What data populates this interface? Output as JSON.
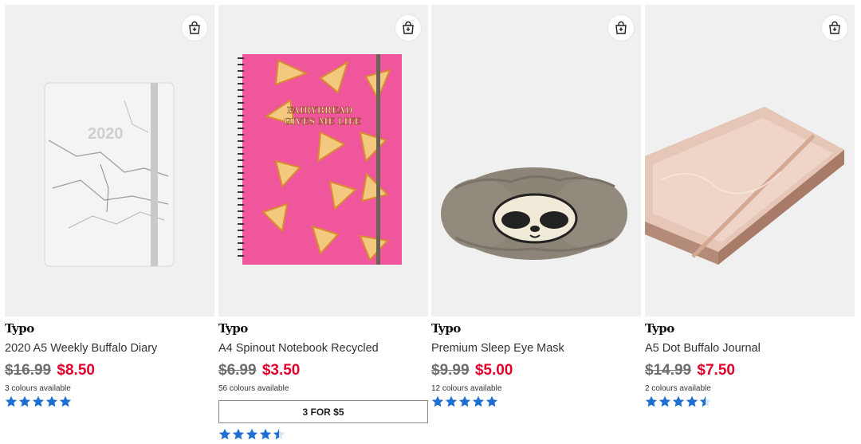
{
  "products": [
    {
      "brand": "Typo",
      "name": "2020 A5 Weekly Buffalo Diary",
      "was_price": "$16.99",
      "now_price": "$8.50",
      "colours": "3 colours available",
      "promo": "",
      "rating": 5,
      "cover_text": "2020"
    },
    {
      "brand": "Typo",
      "name": "A4 Spinout Notebook Recycled",
      "was_price": "$6.99",
      "now_price": "$3.50",
      "colours": "56 colours available",
      "promo": "3 FOR $5",
      "rating": 4.5,
      "cover_text_1": "FAIRYBREAD",
      "cover_text_2": "GIVES ME LIFE"
    },
    {
      "brand": "Typo",
      "name": "Premium Sleep Eye Mask",
      "was_price": "$9.99",
      "now_price": "$5.00",
      "colours": "12 colours available",
      "promo": "",
      "rating": 5
    },
    {
      "brand": "Typo",
      "name": "A5 Dot Buffalo Journal",
      "was_price": "$14.99",
      "now_price": "$7.50",
      "colours": "2 colours available",
      "promo": "",
      "rating": 4.5
    }
  ],
  "icons": {
    "add_to_bag": "shopping-bag-plus-icon",
    "rating": "star-icon"
  },
  "colors": {
    "sale_price": "#e4002b",
    "was_price": "#6e6e6e",
    "star": "#1f6fd1",
    "promo_border": "#888888"
  }
}
